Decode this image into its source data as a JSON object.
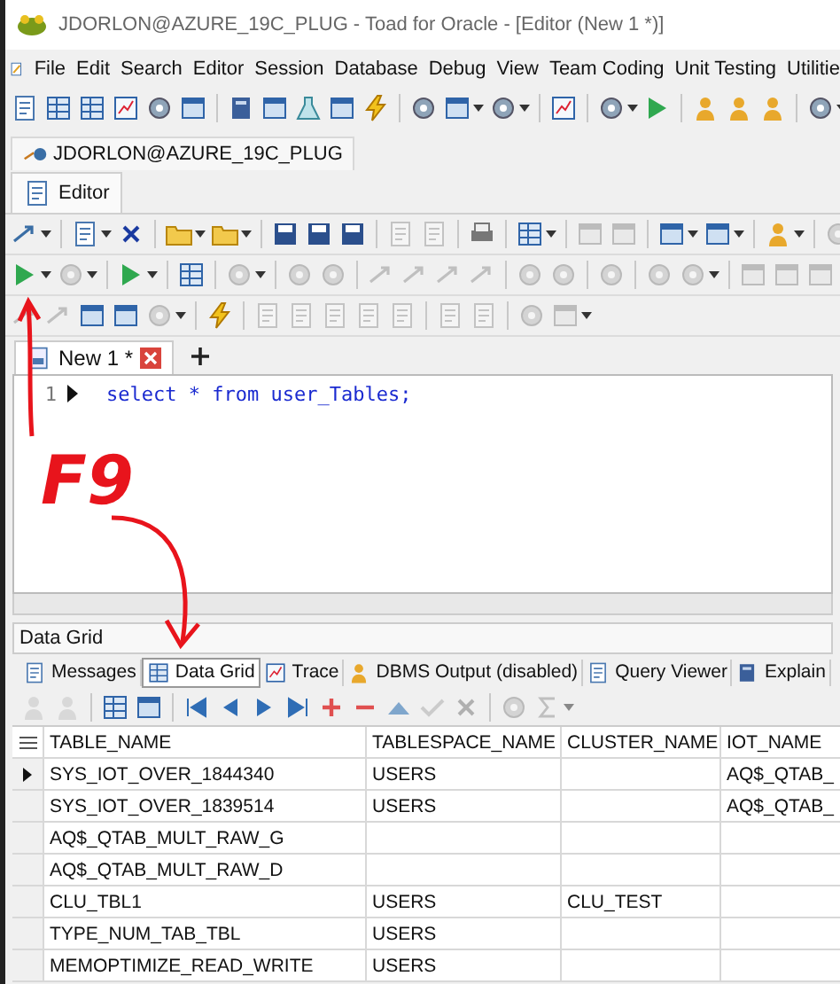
{
  "window": {
    "title": "JDORLON@AZURE_19C_PLUG - Toad for Oracle - [Editor (New 1 *)]"
  },
  "menu": [
    "File",
    "Edit",
    "Search",
    "Editor",
    "Session",
    "Database",
    "Debug",
    "View",
    "Team Coding",
    "Unit Testing",
    "Utilitie"
  ],
  "main_toolbar": [
    {
      "kind": "doc",
      "disabled": false
    },
    {
      "kind": "grid",
      "disabled": false
    },
    {
      "kind": "grid",
      "disabled": false
    },
    {
      "kind": "chart",
      "disabled": false
    },
    {
      "kind": "gear",
      "disabled": false
    },
    {
      "kind": "window",
      "disabled": false
    },
    {
      "kind": "sep"
    },
    {
      "kind": "book",
      "disabled": false
    },
    {
      "kind": "window",
      "disabled": false
    },
    {
      "kind": "flask",
      "disabled": false
    },
    {
      "kind": "window",
      "disabled": false
    },
    {
      "kind": "bolt",
      "disabled": false
    },
    {
      "kind": "sep"
    },
    {
      "kind": "gear",
      "disabled": false
    },
    {
      "kind": "window",
      "disabled": false,
      "dropdown": true
    },
    {
      "kind": "gear",
      "disabled": false,
      "dropdown": true
    },
    {
      "kind": "sep"
    },
    {
      "kind": "chart",
      "disabled": false
    },
    {
      "kind": "sep"
    },
    {
      "kind": "gear",
      "disabled": false,
      "dropdown": true
    },
    {
      "kind": "play",
      "disabled": false
    },
    {
      "kind": "sep"
    },
    {
      "kind": "person",
      "disabled": false
    },
    {
      "kind": "person",
      "disabled": false
    },
    {
      "kind": "person",
      "disabled": false
    },
    {
      "kind": "sep"
    },
    {
      "kind": "gear",
      "disabled": false,
      "dropdown": true
    }
  ],
  "connection": {
    "label": "JDORLON@AZURE_19C_PLUG"
  },
  "editor_tab": {
    "label": "Editor",
    "selected": true
  },
  "editor_toolbars": [
    [
      {
        "kind": "arrow",
        "disabled": false,
        "dropdown": true
      },
      {
        "kind": "sep"
      },
      {
        "kind": "doc",
        "disabled": false,
        "dropdown": true
      },
      {
        "kind": "cross",
        "disabled": false
      },
      {
        "kind": "sep"
      },
      {
        "kind": "folder",
        "disabled": false,
        "dropdown": true
      },
      {
        "kind": "folder",
        "disabled": false,
        "dropdown": true
      },
      {
        "kind": "sep"
      },
      {
        "kind": "disk",
        "disabled": false
      },
      {
        "kind": "disk",
        "disabled": false
      },
      {
        "kind": "disk",
        "disabled": false
      },
      {
        "kind": "sep"
      },
      {
        "kind": "doc",
        "disabled": true
      },
      {
        "kind": "doc",
        "disabled": true
      },
      {
        "kind": "sep"
      },
      {
        "kind": "print",
        "disabled": false
      },
      {
        "kind": "sep"
      },
      {
        "kind": "grid",
        "disabled": false,
        "dropdown": true
      },
      {
        "kind": "sep"
      },
      {
        "kind": "window",
        "disabled": true
      },
      {
        "kind": "window",
        "disabled": true
      },
      {
        "kind": "sep"
      },
      {
        "kind": "window",
        "disabled": false,
        "dropdown": true
      },
      {
        "kind": "window",
        "disabled": false,
        "dropdown": true
      },
      {
        "kind": "sep"
      },
      {
        "kind": "person",
        "disabled": false,
        "dropdown": true
      },
      {
        "kind": "sep"
      },
      {
        "kind": "gear",
        "disabled": true
      }
    ],
    [
      {
        "kind": "play",
        "disabled": false,
        "dropdown": true
      },
      {
        "kind": "gear",
        "disabled": true,
        "dropdown": true
      },
      {
        "kind": "sep"
      },
      {
        "kind": "play",
        "disabled": false,
        "dropdown": true
      },
      {
        "kind": "sep"
      },
      {
        "kind": "grid",
        "disabled": false
      },
      {
        "kind": "sep"
      },
      {
        "kind": "gear",
        "disabled": true,
        "dropdown": true
      },
      {
        "kind": "sep"
      },
      {
        "kind": "gear",
        "disabled": true
      },
      {
        "kind": "gear",
        "disabled": true
      },
      {
        "kind": "sep"
      },
      {
        "kind": "arrow",
        "disabled": true
      },
      {
        "kind": "arrow",
        "disabled": true
      },
      {
        "kind": "arrow",
        "disabled": true
      },
      {
        "kind": "arrow",
        "disabled": true
      },
      {
        "kind": "sep"
      },
      {
        "kind": "gear",
        "disabled": true
      },
      {
        "kind": "gear",
        "disabled": true
      },
      {
        "kind": "sep"
      },
      {
        "kind": "gear",
        "disabled": true
      },
      {
        "kind": "sep"
      },
      {
        "kind": "gear",
        "disabled": true
      },
      {
        "kind": "gear",
        "disabled": true,
        "dropdown": true
      },
      {
        "kind": "sep"
      },
      {
        "kind": "window",
        "disabled": true
      },
      {
        "kind": "window",
        "disabled": true
      },
      {
        "kind": "window",
        "disabled": true
      }
    ],
    [
      {
        "kind": "arrow",
        "disabled": true
      },
      {
        "kind": "arrow",
        "disabled": true
      },
      {
        "kind": "window",
        "disabled": false
      },
      {
        "kind": "window",
        "disabled": false
      },
      {
        "kind": "gear",
        "disabled": true,
        "dropdown": true
      },
      {
        "kind": "sep"
      },
      {
        "kind": "bolt",
        "disabled": false
      },
      {
        "kind": "sep"
      },
      {
        "kind": "doc",
        "disabled": true
      },
      {
        "kind": "doc",
        "disabled": true
      },
      {
        "kind": "doc",
        "disabled": true
      },
      {
        "kind": "doc",
        "disabled": true
      },
      {
        "kind": "doc",
        "disabled": true
      },
      {
        "kind": "sep"
      },
      {
        "kind": "doc",
        "disabled": true
      },
      {
        "kind": "doc",
        "disabled": true
      },
      {
        "kind": "sep"
      },
      {
        "kind": "gear",
        "disabled": true
      },
      {
        "kind": "window",
        "disabled": true,
        "dropdown": true
      }
    ]
  ],
  "document_tabs": [
    {
      "label": "New 1 *",
      "selected": true
    }
  ],
  "editor": {
    "lines": [
      {
        "number": "1",
        "current": true,
        "code": "select * from user_Tables;"
      }
    ]
  },
  "annotations": [
    {
      "label": "F9",
      "color": "#e8141c"
    }
  ],
  "results": {
    "title": "Data Grid",
    "tabs": [
      {
        "label": "Messages",
        "kind": "doc",
        "selected": false
      },
      {
        "label": "Data Grid",
        "kind": "grid",
        "selected": true
      },
      {
        "label": "Trace",
        "kind": "chart",
        "selected": false
      },
      {
        "label": "DBMS Output (disabled)",
        "kind": "person",
        "selected": false
      },
      {
        "label": "Query Viewer",
        "kind": "doc",
        "selected": false
      },
      {
        "label": "Explain",
        "kind": "book",
        "selected": false
      }
    ],
    "toolbar": [
      {
        "kind": "person",
        "disabled": true
      },
      {
        "kind": "person",
        "disabled": true
      },
      {
        "kind": "sep"
      },
      {
        "kind": "grid",
        "disabled": false
      },
      {
        "kind": "window",
        "disabled": false
      },
      {
        "kind": "sep"
      },
      {
        "kind": "first",
        "disabled": false
      },
      {
        "kind": "prev",
        "disabled": false
      },
      {
        "kind": "next",
        "disabled": false
      },
      {
        "kind": "last",
        "disabled": false
      },
      {
        "kind": "plus",
        "disabled": false
      },
      {
        "kind": "minus",
        "disabled": false
      },
      {
        "kind": "up",
        "disabled": false
      },
      {
        "kind": "check",
        "disabled": true
      },
      {
        "kind": "cross",
        "disabled": true
      },
      {
        "kind": "sep"
      },
      {
        "kind": "gear",
        "disabled": true
      },
      {
        "kind": "sigma",
        "disabled": true,
        "dropdown": true
      }
    ],
    "columns": [
      "TABLE_NAME",
      "TABLESPACE_NAME",
      "CLUSTER_NAME",
      "IOT_NAME"
    ],
    "rows": [
      {
        "current": true,
        "cells": [
          "SYS_IOT_OVER_1844340",
          "USERS",
          "",
          "AQ$_QTAB_"
        ]
      },
      {
        "current": false,
        "cells": [
          "SYS_IOT_OVER_1839514",
          "USERS",
          "",
          "AQ$_QTAB_"
        ]
      },
      {
        "current": false,
        "cells": [
          "AQ$_QTAB_MULT_RAW_G",
          "",
          "",
          ""
        ]
      },
      {
        "current": false,
        "cells": [
          "AQ$_QTAB_MULT_RAW_D",
          "",
          "",
          ""
        ]
      },
      {
        "current": false,
        "cells": [
          "CLU_TBL1",
          "USERS",
          "CLU_TEST",
          ""
        ]
      },
      {
        "current": false,
        "cells": [
          "TYPE_NUM_TAB_TBL",
          "USERS",
          "",
          ""
        ]
      },
      {
        "current": false,
        "cells": [
          "MEMOPTIMIZE_READ_WRITE",
          "USERS",
          "",
          ""
        ]
      }
    ]
  }
}
